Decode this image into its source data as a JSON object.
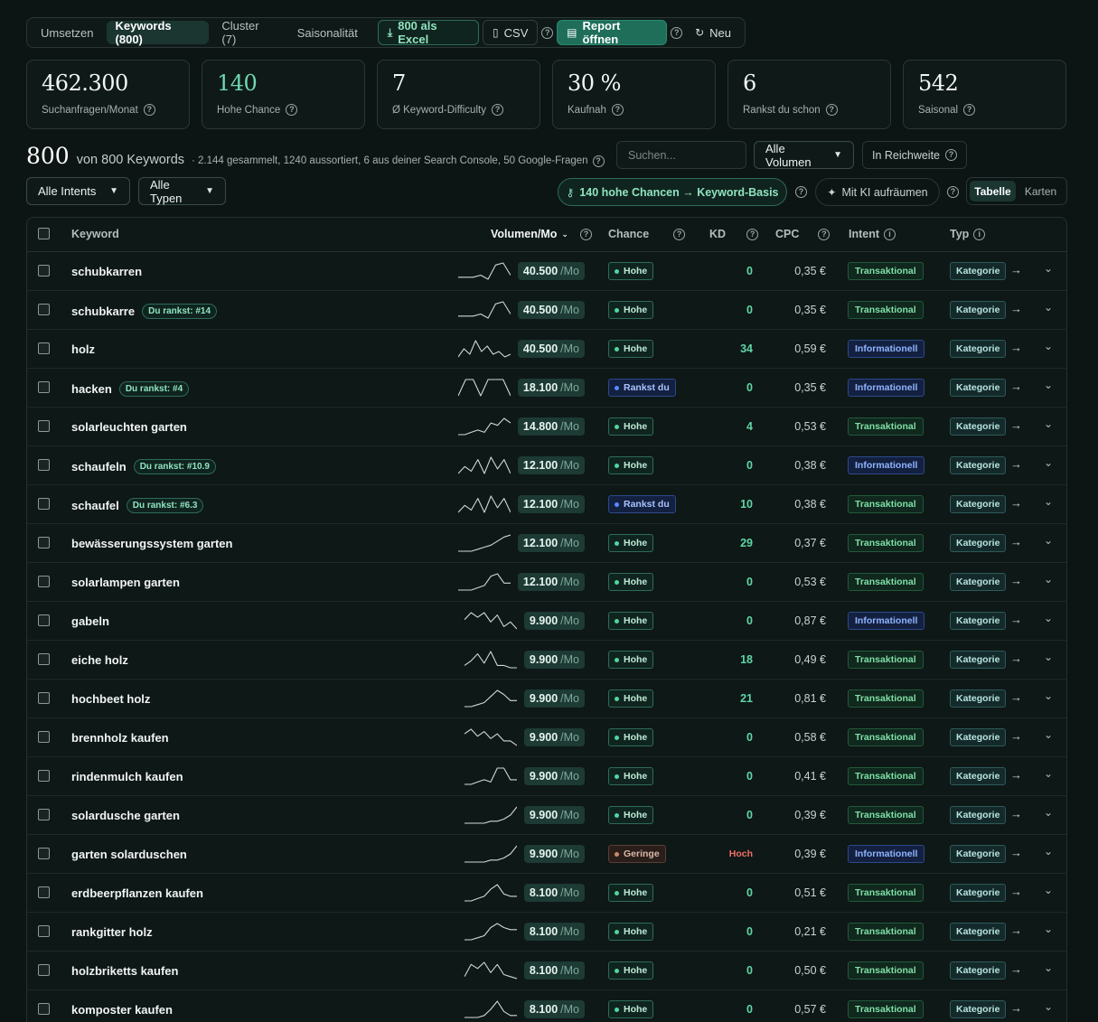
{
  "tabs": [
    {
      "label": "Umsetzen",
      "active": false
    },
    {
      "label": "Keywords (800)",
      "active": true
    },
    {
      "label": "Cluster (7)",
      "active": false
    },
    {
      "label": "Saisonalität",
      "active": false
    }
  ],
  "toolbar": {
    "excel_label": "800 als Excel",
    "csv_label": "CSV",
    "report_label": "Report öffnen",
    "new_label": "Neu"
  },
  "stats": [
    {
      "value": "462.300",
      "label": "Suchanfragen/Monat",
      "accent": false
    },
    {
      "value": "140",
      "label": "Hohe Chance",
      "accent": true
    },
    {
      "value": "7",
      "label": "Ø Keyword-Difficulty",
      "accent": false
    },
    {
      "value": "30 %",
      "label": "Kaufnah",
      "accent": false
    },
    {
      "value": "6",
      "label": "Rankst du schon",
      "accent": false
    },
    {
      "value": "542",
      "label": "Saisonal",
      "accent": false
    }
  ],
  "summary": {
    "count": "800",
    "of_text": "von 800 Keywords",
    "meta": "· 2.144 gesammelt, 1240 aussortiert, 6 aus deiner Search Console, 50 Google-Fragen"
  },
  "search": {
    "placeholder": "Suchen..."
  },
  "filters": {
    "volume": "Alle Volumen",
    "reach": "In Reichweite",
    "intent": "Alle Intents",
    "types": "Alle Typen"
  },
  "actions": {
    "chancen": "140 hohe Chancen → Keyword-Basis",
    "ki": "Mit KI aufräumen"
  },
  "view": {
    "table": "Tabelle",
    "cards": "Karten"
  },
  "table": {
    "headers": {
      "keyword": "Keyword",
      "volume": "Volumen/Mo",
      "chance": "Chance",
      "kd": "KD",
      "cpc": "CPC",
      "intent": "Intent",
      "typ": "Typ"
    },
    "unit": "/Mo",
    "rows": [
      {
        "keyword": "schubkarren",
        "rank": "",
        "volume": "40.500",
        "chance": "Hohe",
        "chance_type": "hohe",
        "kd": "0",
        "cpc": "0,35 €",
        "intent": "Transaktional",
        "intent_type": "trans",
        "typ": "Kategorie",
        "spark": [
          2,
          2,
          2,
          3,
          1,
          8,
          9,
          3
        ]
      },
      {
        "keyword": "schubkarre",
        "rank": "Du rankst: #14",
        "volume": "40.500",
        "chance": "Hohe",
        "chance_type": "hohe",
        "kd": "0",
        "cpc": "0,35 €",
        "intent": "Transaktional",
        "intent_type": "trans",
        "typ": "Kategorie",
        "spark": [
          2,
          2,
          2,
          3,
          1,
          8,
          9,
          3
        ]
      },
      {
        "keyword": "holz",
        "rank": "",
        "volume": "40.500",
        "chance": "Hohe",
        "chance_type": "hohe",
        "kd": "34",
        "cpc": "0,59 €",
        "intent": "Informationell",
        "intent_type": "info",
        "typ": "Kategorie",
        "spark": [
          3,
          6,
          4,
          9,
          5,
          7,
          4,
          5,
          3,
          4
        ]
      },
      {
        "keyword": "hacken",
        "rank": "Du rankst: #4",
        "volume": "18.100",
        "chance": "Rankst du",
        "chance_type": "rankst",
        "kd": "0",
        "cpc": "0,35 €",
        "intent": "Informationell",
        "intent_type": "info",
        "typ": "Kategorie",
        "spark": [
          1,
          9,
          9,
          1,
          9,
          9,
          9,
          1
        ]
      },
      {
        "keyword": "solarleuchten garten",
        "rank": "",
        "volume": "14.800",
        "chance": "Hohe",
        "chance_type": "hohe",
        "kd": "4",
        "cpc": "0,53 €",
        "intent": "Transaktional",
        "intent_type": "trans",
        "typ": "Kategorie",
        "spark": [
          1,
          1,
          2,
          3,
          2,
          6,
          5,
          8,
          6
        ]
      },
      {
        "keyword": "schaufeln",
        "rank": "Du rankst: #10.9",
        "volume": "12.100",
        "chance": "Hohe",
        "chance_type": "hohe",
        "kd": "0",
        "cpc": "0,38 €",
        "intent": "Informationell",
        "intent_type": "info",
        "typ": "Kategorie",
        "spark": [
          2,
          5,
          3,
          8,
          2,
          9,
          4,
          8,
          2
        ]
      },
      {
        "keyword": "schaufel",
        "rank": "Du rankst: #6.3",
        "volume": "12.100",
        "chance": "Rankst du",
        "chance_type": "rankst",
        "kd": "10",
        "cpc": "0,38 €",
        "intent": "Transaktional",
        "intent_type": "trans",
        "typ": "Kategorie",
        "spark": [
          2,
          5,
          3,
          8,
          2,
          9,
          4,
          8,
          2
        ]
      },
      {
        "keyword": "bewässerungssystem garten",
        "rank": "",
        "volume": "12.100",
        "chance": "Hohe",
        "chance_type": "hohe",
        "kd": "29",
        "cpc": "0,37 €",
        "intent": "Transaktional",
        "intent_type": "trans",
        "typ": "Kategorie",
        "spark": [
          1,
          1,
          1,
          2,
          3,
          4,
          6,
          8,
          9
        ]
      },
      {
        "keyword": "solarlampen garten",
        "rank": "",
        "volume": "12.100",
        "chance": "Hohe",
        "chance_type": "hohe",
        "kd": "0",
        "cpc": "0,53 €",
        "intent": "Transaktional",
        "intent_type": "trans",
        "typ": "Kategorie",
        "spark": [
          1,
          1,
          1,
          2,
          3,
          7,
          8,
          4,
          4
        ]
      },
      {
        "keyword": "gabeln",
        "rank": "",
        "volume": "9.900",
        "chance": "Hohe",
        "chance_type": "hohe",
        "kd": "0",
        "cpc": "0,87 €",
        "intent": "Informationell",
        "intent_type": "info",
        "typ": "Kategorie",
        "spark": [
          6,
          9,
          7,
          9,
          5,
          8,
          3,
          5,
          2
        ]
      },
      {
        "keyword": "eiche holz",
        "rank": "",
        "volume": "9.900",
        "chance": "Hohe",
        "chance_type": "hohe",
        "kd": "18",
        "cpc": "0,49 €",
        "intent": "Transaktional",
        "intent_type": "trans",
        "typ": "Kategorie",
        "spark": [
          3,
          5,
          8,
          4,
          9,
          3,
          3,
          2,
          2
        ]
      },
      {
        "keyword": "hochbeet holz",
        "rank": "",
        "volume": "9.900",
        "chance": "Hohe",
        "chance_type": "hohe",
        "kd": "21",
        "cpc": "0,81 €",
        "intent": "Transaktional",
        "intent_type": "trans",
        "typ": "Kategorie",
        "spark": [
          1,
          1,
          2,
          3,
          6,
          9,
          7,
          4,
          4
        ]
      },
      {
        "keyword": "brennholz kaufen",
        "rank": "",
        "volume": "9.900",
        "chance": "Hohe",
        "chance_type": "hohe",
        "kd": "0",
        "cpc": "0,58 €",
        "intent": "Transaktional",
        "intent_type": "trans",
        "typ": "Kategorie",
        "spark": [
          7,
          9,
          6,
          8,
          5,
          7,
          4,
          4,
          2
        ]
      },
      {
        "keyword": "rindenmulch kaufen",
        "rank": "",
        "volume": "9.900",
        "chance": "Hohe",
        "chance_type": "hohe",
        "kd": "0",
        "cpc": "0,41 €",
        "intent": "Transaktional",
        "intent_type": "trans",
        "typ": "Kategorie",
        "spark": [
          1,
          1,
          2,
          3,
          2,
          8,
          8,
          3,
          3
        ]
      },
      {
        "keyword": "solardusche garten",
        "rank": "",
        "volume": "9.900",
        "chance": "Hohe",
        "chance_type": "hohe",
        "kd": "0",
        "cpc": "0,39 €",
        "intent": "Transaktional",
        "intent_type": "trans",
        "typ": "Kategorie",
        "spark": [
          1,
          1,
          1,
          1,
          2,
          2,
          3,
          5,
          9
        ]
      },
      {
        "keyword": "garten solarduschen",
        "rank": "",
        "volume": "9.900",
        "chance": "Geringe",
        "chance_type": "geringe",
        "kd": "Hoch",
        "cpc": "0,39 €",
        "intent": "Informationell",
        "intent_type": "info",
        "typ": "Kategorie",
        "spark": [
          1,
          1,
          1,
          1,
          2,
          2,
          3,
          5,
          9
        ]
      },
      {
        "keyword": "erdbeerpflanzen kaufen",
        "rank": "",
        "volume": "8.100",
        "chance": "Hohe",
        "chance_type": "hohe",
        "kd": "0",
        "cpc": "0,51 €",
        "intent": "Transaktional",
        "intent_type": "trans",
        "typ": "Kategorie",
        "spark": [
          1,
          1,
          2,
          3,
          6,
          8,
          4,
          3,
          3
        ]
      },
      {
        "keyword": "rankgitter holz",
        "rank": "",
        "volume": "8.100",
        "chance": "Hohe",
        "chance_type": "hohe",
        "kd": "0",
        "cpc": "0,21 €",
        "intent": "Transaktional",
        "intent_type": "trans",
        "typ": "Kategorie",
        "spark": [
          1,
          1,
          2,
          3,
          7,
          9,
          7,
          6,
          6
        ]
      },
      {
        "keyword": "holzbriketts kaufen",
        "rank": "",
        "volume": "8.100",
        "chance": "Hohe",
        "chance_type": "hohe",
        "kd": "0",
        "cpc": "0,50 €",
        "intent": "Transaktional",
        "intent_type": "trans",
        "typ": "Kategorie",
        "spark": [
          2,
          8,
          6,
          9,
          4,
          8,
          3,
          2,
          1
        ]
      },
      {
        "keyword": "komposter kaufen",
        "rank": "",
        "volume": "8.100",
        "chance": "Hohe",
        "chance_type": "hohe",
        "kd": "0",
        "cpc": "0,57 €",
        "intent": "Transaktional",
        "intent_type": "trans",
        "typ": "Kategorie",
        "spark": [
          1,
          1,
          1,
          2,
          5,
          9,
          4,
          2,
          2
        ]
      }
    ]
  }
}
